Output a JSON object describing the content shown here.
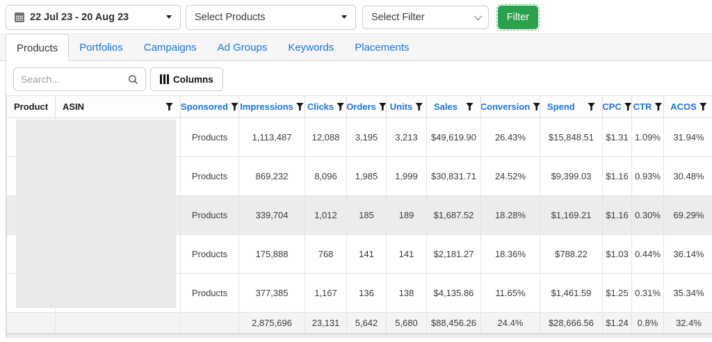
{
  "topbar": {
    "date_range": "22 Jul 23 - 20 Aug 23",
    "select_products": "Select Products",
    "select_filter": "Select Filter",
    "filter_button": "Filter"
  },
  "tabs": [
    {
      "label": "Products",
      "active": true
    },
    {
      "label": "Portfolios",
      "active": false
    },
    {
      "label": "Campaigns",
      "active": false
    },
    {
      "label": "Ad Groups",
      "active": false
    },
    {
      "label": "Keywords",
      "active": false
    },
    {
      "label": "Placements",
      "active": false
    }
  ],
  "toolbar": {
    "search_placeholder": "Search...",
    "columns_button": "Columns"
  },
  "table": {
    "columns": [
      "Product",
      "ASIN",
      "Sponsored",
      "Impressions",
      "Clicks",
      "Orders",
      "Units",
      "Sales",
      "Conversion",
      "Spend",
      "CPC",
      "CTR",
      "ACOS"
    ],
    "rows": [
      {
        "sponsored": "Products",
        "impressions": "1,113,487",
        "clicks": "12,088",
        "orders": "3,195",
        "units": "3,213",
        "sales": "$49,619.90",
        "conversion": "26.43%",
        "spend": "$15,848.51",
        "cpc": "$1.31",
        "ctr": "1.09%",
        "acos": "31.94%"
      },
      {
        "sponsored": "Products",
        "impressions": "869,232",
        "clicks": "8,096",
        "orders": "1,985",
        "units": "1,999",
        "sales": "$30,831.71",
        "conversion": "24.52%",
        "spend": "$9,399.03",
        "cpc": "$1.16",
        "ctr": "0.93%",
        "acos": "30.48%"
      },
      {
        "sponsored": "Products",
        "impressions": "339,704",
        "clicks": "1,012",
        "orders": "185",
        "units": "189",
        "sales": "$1,687.52",
        "conversion": "18.28%",
        "spend": "$1,169.21",
        "cpc": "$1.16",
        "ctr": "0.30%",
        "acos": "69.29%"
      },
      {
        "sponsored": "Products",
        "impressions": "175,888",
        "clicks": "768",
        "orders": "141",
        "units": "141",
        "sales": "$2,181.27",
        "conversion": "18.36%",
        "spend": "$788.22",
        "cpc": "$1.03",
        "ctr": "0.44%",
        "acos": "36.14%"
      },
      {
        "sponsored": "Products",
        "impressions": "377,385",
        "clicks": "1,167",
        "orders": "136",
        "units": "138",
        "sales": "$4,135.86",
        "conversion": "11.65%",
        "spend": "$1,461.59",
        "cpc": "$1.25",
        "ctr": "0.31%",
        "acos": "35.34%"
      }
    ],
    "total": {
      "impressions": "2,875,696",
      "clicks": "23,131",
      "orders": "5,642",
      "units": "5,680",
      "sales": "$88,456.26",
      "conversion": "24.4%",
      "spend": "$28,666.56",
      "cpc": "$1.24",
      "ctr": "0.8%",
      "acos": "32.4%"
    }
  },
  "colors": {
    "accent_green": "#2aa14b",
    "link_blue": "#1a73e8",
    "row_highlight": "#ececec"
  }
}
